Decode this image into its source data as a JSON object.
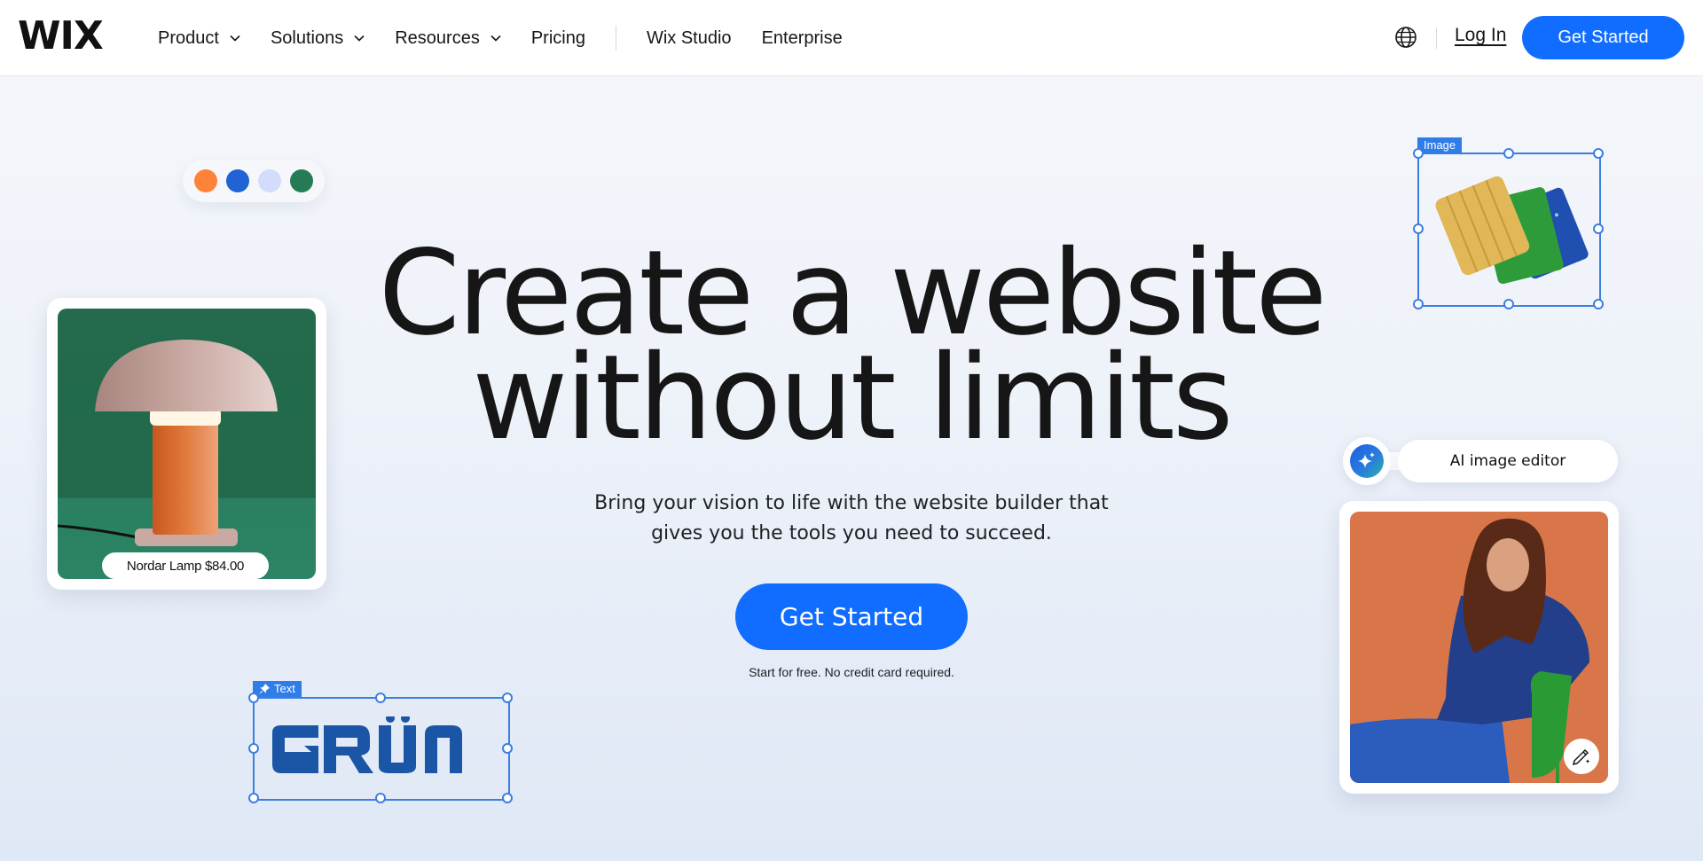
{
  "header": {
    "logo": "WIX",
    "nav": [
      {
        "label": "Product",
        "has_dropdown": true
      },
      {
        "label": "Solutions",
        "has_dropdown": true
      },
      {
        "label": "Resources",
        "has_dropdown": true
      },
      {
        "label": "Pricing",
        "has_dropdown": false
      },
      {
        "label": "Wix Studio",
        "has_dropdown": false
      },
      {
        "label": "Enterprise",
        "has_dropdown": false
      }
    ],
    "language_icon": "globe-icon",
    "login_label": "Log In",
    "cta_label": "Get Started"
  },
  "hero": {
    "title_line1": "Create a website",
    "title_line2": "without limits",
    "subtitle_line1": "Bring your vision to life with the website builder that",
    "subtitle_line2": "gives you the tools you need to succeed.",
    "cta_label": "Get Started",
    "note": "Start for free. No credit card required."
  },
  "palette": {
    "colors": [
      "#ff8239",
      "#1f63d4",
      "#d3dcfa",
      "#257b56"
    ]
  },
  "product_card": {
    "tag": "Nordar Lamp $84.00"
  },
  "text_element": {
    "tag_label": "Text",
    "tag_icon": "pin-icon",
    "content": "GRÜN"
  },
  "image_element": {
    "tag_label": "Image"
  },
  "ai_editor": {
    "label": "AI image editor",
    "icon": "sparkle-icon",
    "edit_icon": "magic-pencil-icon"
  },
  "colors": {
    "accent": "#116dff",
    "selection": "#3b7fe0",
    "text": "#161616"
  }
}
